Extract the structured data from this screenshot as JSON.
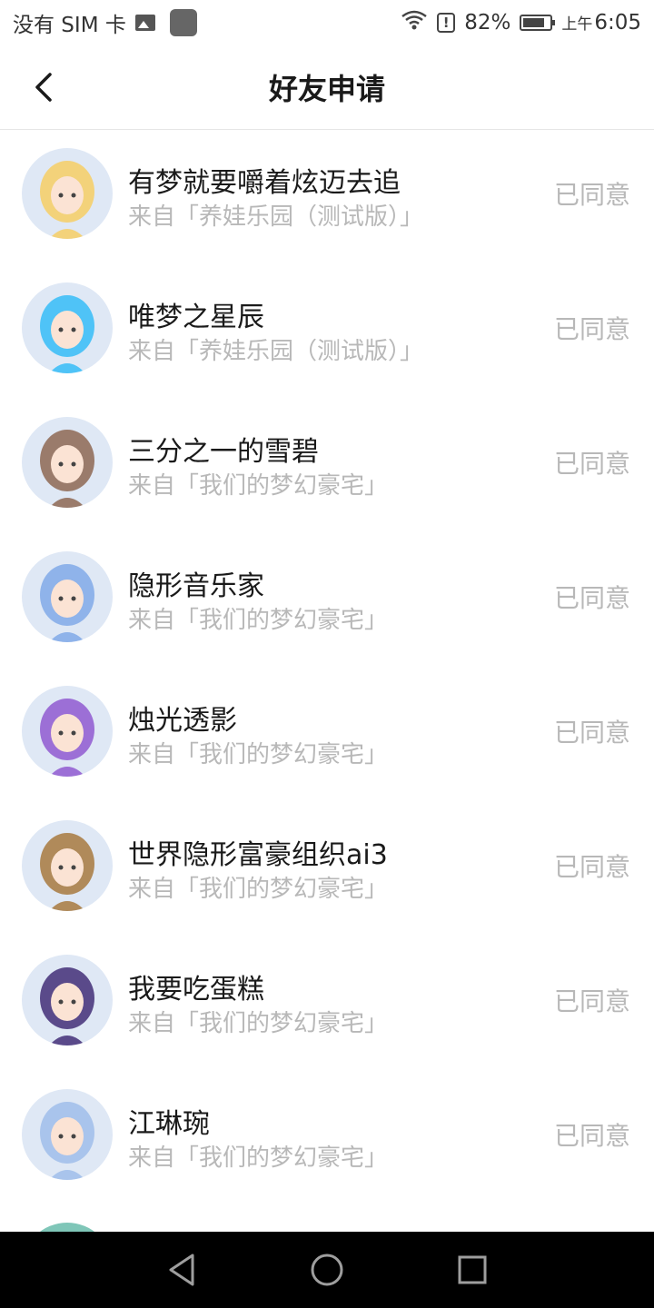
{
  "status_bar": {
    "carrier": "没有 SIM 卡",
    "battery": "82%",
    "battery_level": 0.82,
    "time_prefix": "上午",
    "time": "6:05"
  },
  "header": {
    "title": "好友申请"
  },
  "requests": [
    {
      "name": "有梦就要嚼着炫迈去追",
      "source": "来自「养娃乐园（测试版）」",
      "status": "已同意",
      "avatar_color": "#f3d27a"
    },
    {
      "name": "唯梦之星辰",
      "source": "来自「养娃乐园（测试版）」",
      "status": "已同意",
      "avatar_color": "#4fc3f7"
    },
    {
      "name": "三分之一的雪碧",
      "source": "来自「我们的梦幻豪宅」",
      "status": "已同意",
      "avatar_color": "#9a7b6b"
    },
    {
      "name": "隐形音乐家",
      "source": "来自「我们的梦幻豪宅」",
      "status": "已同意",
      "avatar_color": "#8fb3ea"
    },
    {
      "name": "烛光透影",
      "source": "来自「我们的梦幻豪宅」",
      "status": "已同意",
      "avatar_color": "#9c6fd6"
    },
    {
      "name": "世界隐形富豪组织ai3",
      "source": "来自「我们的梦幻豪宅」",
      "status": "已同意",
      "avatar_color": "#b08a5a"
    },
    {
      "name": "我要吃蛋糕",
      "source": "来自「我们的梦幻豪宅」",
      "status": "已同意",
      "avatar_color": "#5a4a8a"
    },
    {
      "name": "江琳琬",
      "source": "来自「我们的梦幻豪宅」",
      "status": "已同意",
      "avatar_color": "#a9c4ec"
    }
  ]
}
